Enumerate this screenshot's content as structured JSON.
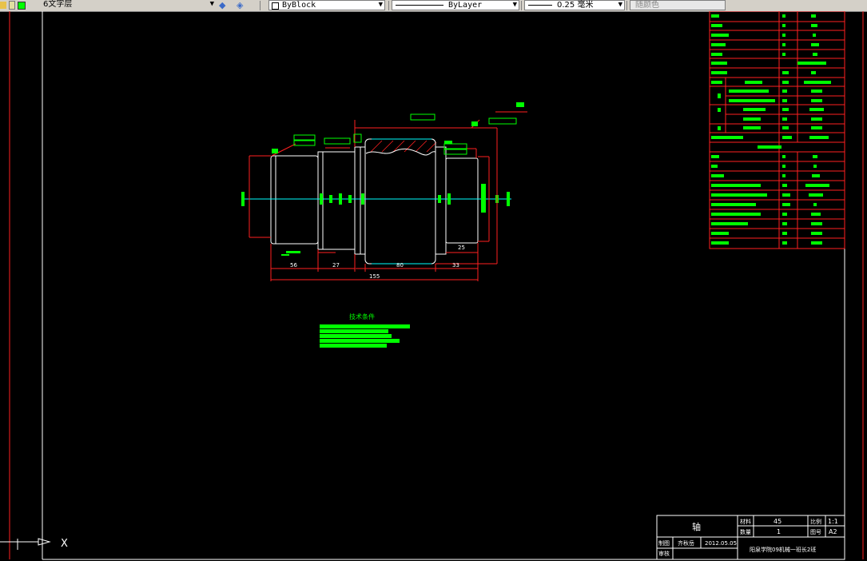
{
  "toolbar": {
    "layer_name": "6文字层",
    "color": "ByBlock",
    "linetype": "ByLayer",
    "lineweight": "0.25 毫米",
    "plot_style": "随颜色"
  },
  "drawing": {
    "dimensions": {
      "d1": "56",
      "d2": "27",
      "d3": "80",
      "d4": "25",
      "d5": "33",
      "overall": "155"
    },
    "tech_requirements_title": "技术条件",
    "ucs_x_label": "X"
  },
  "title_block": {
    "part_name": "轴",
    "material_label": "材料",
    "material_value": "45",
    "scale_label": "比例",
    "scale_value": "1:1",
    "quantity_label": "数量",
    "quantity_value": "1",
    "sheet_label": "图号",
    "sheet_value": "A2",
    "drawn_label": "制图",
    "drawn_by": "齐秋岳",
    "date": "2012.05.05",
    "check_label": "审核",
    "school": "阳泉学院09机械一班长2班"
  }
}
